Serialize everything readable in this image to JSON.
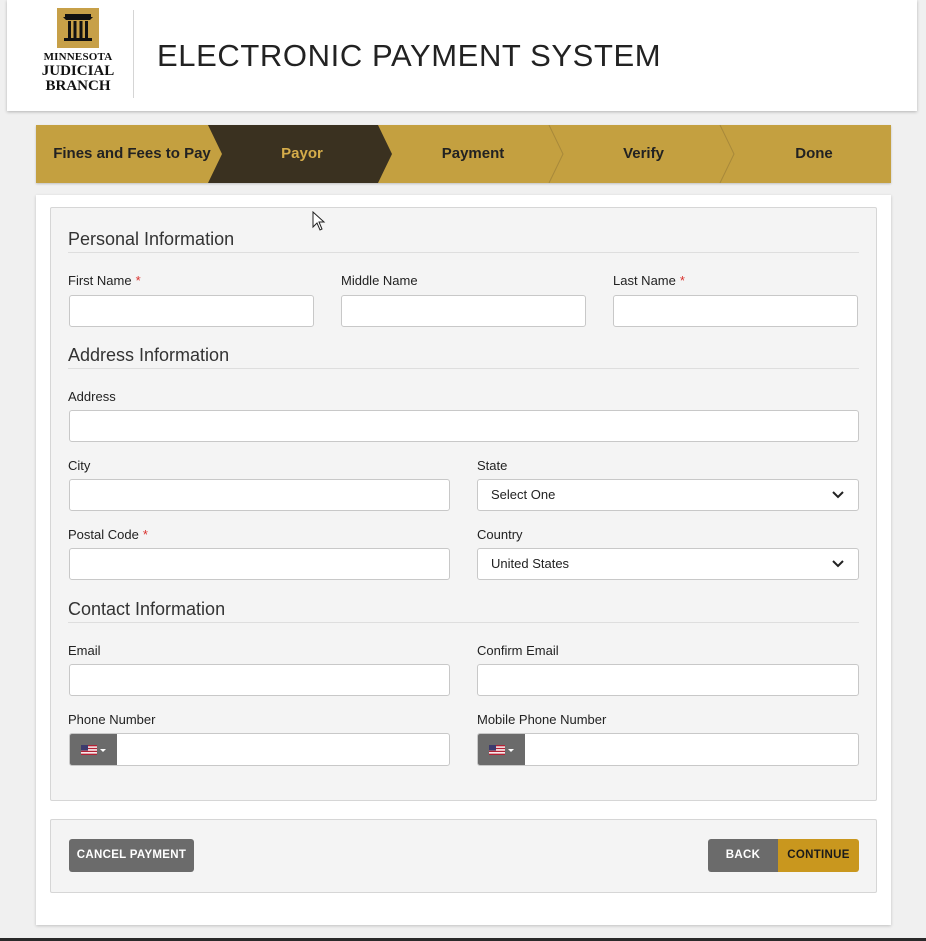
{
  "header": {
    "logo": {
      "line1": "MINNESOTA",
      "line2": "JUDICIAL",
      "line3": "BRANCH",
      "icon": "courthouse-columns-icon"
    },
    "title": "ELECTRONIC PAYMENT SYSTEM"
  },
  "steps": {
    "items": [
      {
        "label": "Fines and Fees to Pay",
        "state": "complete"
      },
      {
        "label": "Payor",
        "state": "active"
      },
      {
        "label": "Payment",
        "state": "pending"
      },
      {
        "label": "Verify",
        "state": "pending"
      },
      {
        "label": "Done",
        "state": "pending"
      }
    ],
    "colors": {
      "bar": "#c4a040",
      "active_bg": "#3a3120",
      "active_text": "#d6ad4a"
    }
  },
  "personal": {
    "title": "Personal Information",
    "first_name": {
      "label": "First Name",
      "required": "*",
      "value": ""
    },
    "middle_name": {
      "label": "Middle Name",
      "value": ""
    },
    "last_name": {
      "label": "Last Name",
      "required": "*",
      "value": ""
    }
  },
  "address": {
    "title": "Address Information",
    "address": {
      "label": "Address",
      "value": ""
    },
    "city": {
      "label": "City",
      "value": ""
    },
    "state": {
      "label": "State",
      "selected": "Select One"
    },
    "postal_code": {
      "label": "Postal Code",
      "required": "*",
      "value": ""
    },
    "country": {
      "label": "Country",
      "selected": "United States"
    }
  },
  "contact": {
    "title": "Contact Information",
    "email": {
      "label": "Email",
      "value": ""
    },
    "confirm_email": {
      "label": "Confirm Email",
      "value": ""
    },
    "phone": {
      "label": "Phone Number",
      "flag": "us-flag-icon",
      "value": ""
    },
    "mobile_phone": {
      "label": "Mobile Phone Number",
      "flag": "us-flag-icon",
      "value": ""
    }
  },
  "actions": {
    "cancel": "CANCEL PAYMENT",
    "back": "BACK",
    "continue": "CONTINUE",
    "colors": {
      "continue_bg": "#c9971e",
      "secondary_bg": "#6b6b6b"
    }
  }
}
